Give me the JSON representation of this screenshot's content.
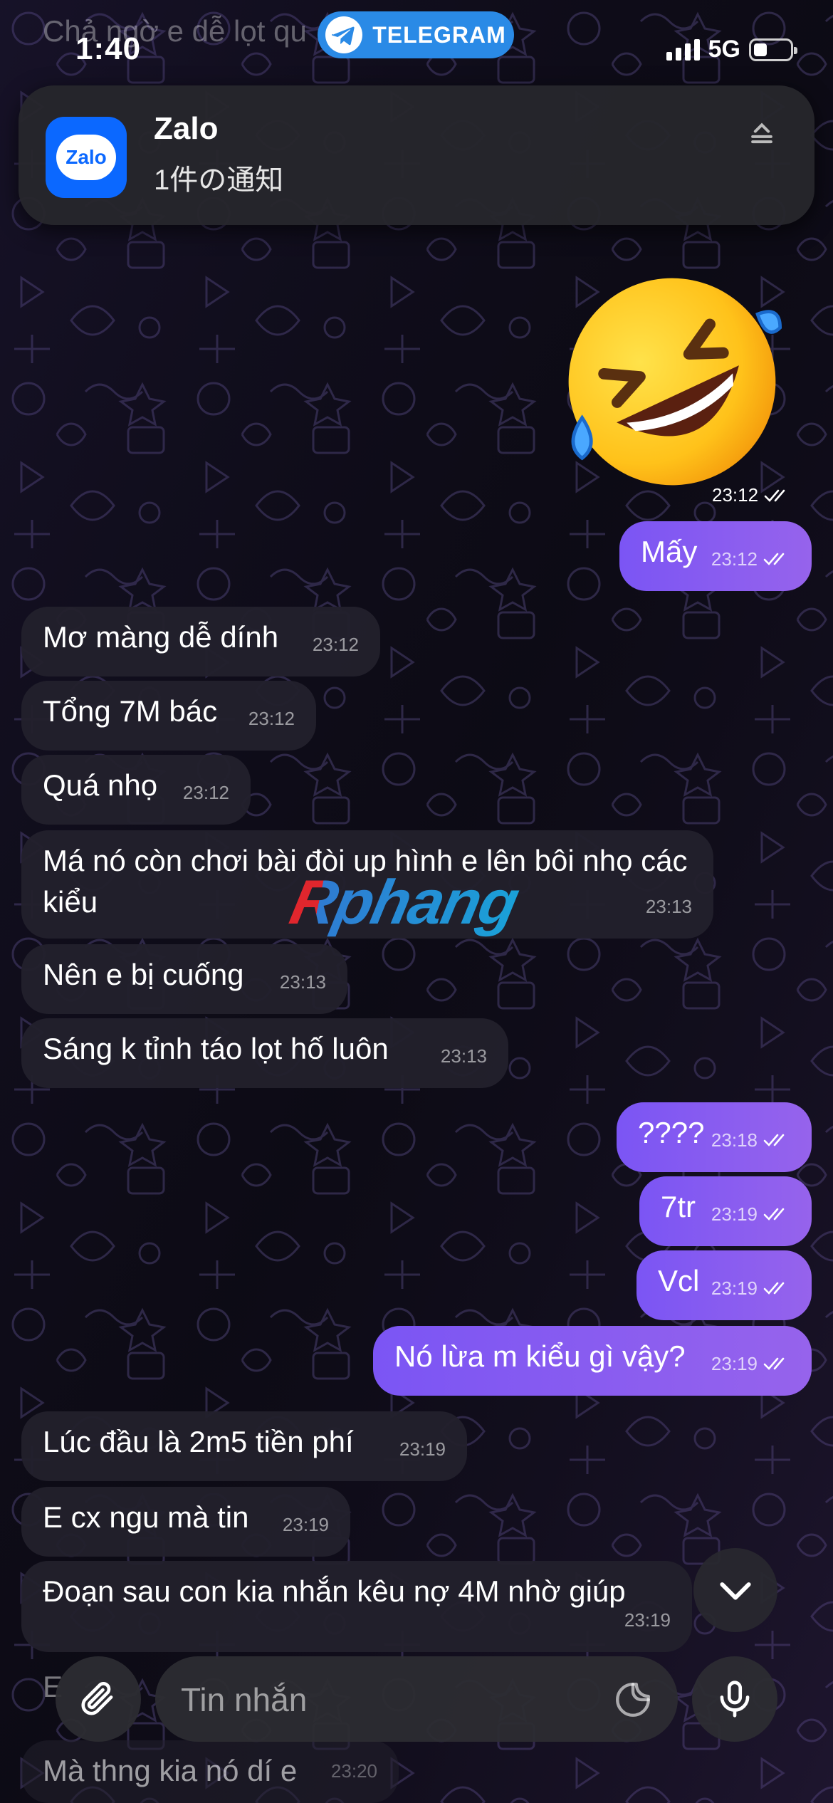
{
  "status_bar": {
    "time": "1:40",
    "pill_label": "TELEGRAM",
    "network": "5G"
  },
  "notification": {
    "app_name": "Zalo",
    "app_icon_text": "Zalo",
    "body": "1件の通知"
  },
  "top_ghost_text": "Chả ngờ e dễ lọt qu",
  "sticker": {
    "emoji": "rolling-on-floor-laughing",
    "time": "23:12"
  },
  "messages": [
    {
      "side": "out",
      "text": "Mấy",
      "time": "23:12"
    },
    {
      "side": "in",
      "text": "Mơ màng dễ dính",
      "time": "23:12"
    },
    {
      "side": "in",
      "text": "Tổng 7M bác",
      "time": "23:12"
    },
    {
      "side": "in",
      "text": "Quá nhọ",
      "time": "23:12"
    },
    {
      "side": "in",
      "text": "Má nó còn chơi bài đòi up hình e lên bôi nhọ các kiểu",
      "time": "23:13"
    },
    {
      "side": "in",
      "text": "Nên e bị cuống",
      "time": "23:13"
    },
    {
      "side": "in",
      "text": "Sáng k tỉnh táo lọt hố luôn",
      "time": "23:13"
    },
    {
      "side": "out",
      "text": "????",
      "time": "23:18"
    },
    {
      "side": "out",
      "text": "7tr",
      "time": "23:19"
    },
    {
      "side": "out",
      "text": "Vcl",
      "time": "23:19"
    },
    {
      "side": "out",
      "text": "Nó lừa m kiểu gì vậy?",
      "time": "23:19"
    },
    {
      "side": "in",
      "text": "Lúc đầu là 2m5 tiền phí",
      "time": "23:19"
    },
    {
      "side": "in",
      "text": "E cx ngu mà tin",
      "time": "23:19"
    },
    {
      "side": "in",
      "text": "Đoạn sau con kia nhắn kêu nợ 4M nhờ giúp",
      "time": "23:19"
    },
    {
      "side": "in",
      "text": "Mà thng kia nó dí e",
      "time": "23:20"
    }
  ],
  "partial_hidden_text": "E",
  "watermark": "Rphang",
  "composer": {
    "placeholder": "Tin nhắn",
    "value": ""
  },
  "icons": {
    "pill": "telegram-plane-icon",
    "attach": "paperclip-icon",
    "sticker": "sticker-icon",
    "mic": "microphone-icon",
    "scroll": "chevron-down-icon",
    "read": "double-check-icon"
  },
  "colors": {
    "outgoing_bubble": "#8a5cf0",
    "incoming_bubble": "#22202c",
    "telegram_blue": "#2a8ae6",
    "zalo_blue": "#0b68ff"
  }
}
